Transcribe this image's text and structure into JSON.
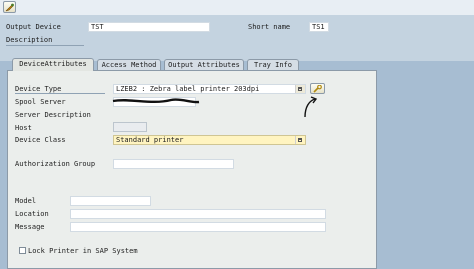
{
  "header": {
    "output_device_label": "Output Device",
    "output_device_value": "TST",
    "short_name_label": "Short name",
    "short_name_value": "TS1",
    "description_label": "Description"
  },
  "tabs": [
    {
      "label": "DeviceAttributes",
      "active": true
    },
    {
      "label": "Access Method",
      "active": false
    },
    {
      "label": "Output Attributes",
      "active": false
    },
    {
      "label": "Tray Info",
      "active": false
    }
  ],
  "fields": {
    "device_type_label": "Device Type",
    "device_type_value": "LZEB2     : Zebra label printer 203dpi",
    "spool_server_label": "Spool Server",
    "server_description_label": "Server Description",
    "host_label": "Host",
    "device_class_label": "Device Class",
    "device_class_value": "Standard printer",
    "authorization_group_label": "Authorization Group",
    "model_label": "Model",
    "location_label": "Location",
    "message_label": "Message",
    "lock_printer_label": "Lock Printer in SAP System"
  },
  "colors": {
    "background": "#a7bdd2",
    "panel": "#ebeeec",
    "required_field": "#fff4c0"
  },
  "icons": [
    "display-change-icon",
    "search-help-icon",
    "wrench-icon"
  ]
}
